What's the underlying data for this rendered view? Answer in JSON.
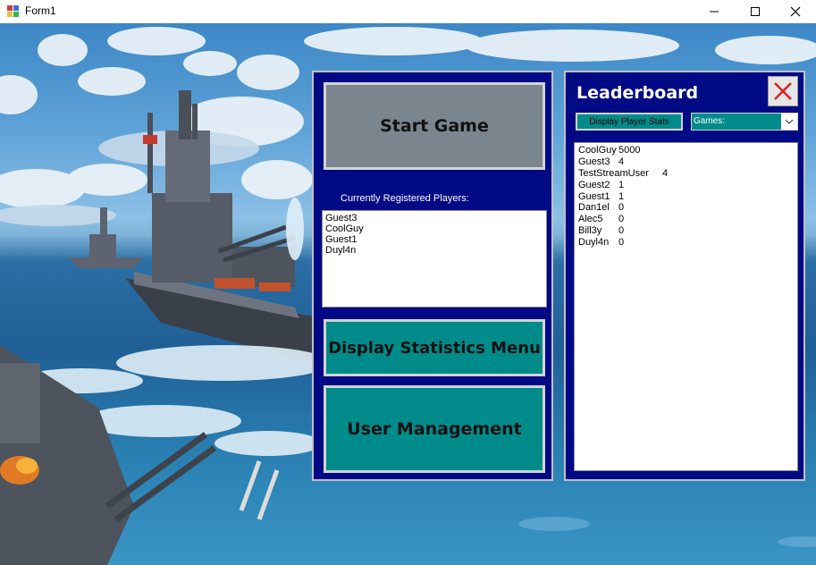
{
  "window": {
    "title": "Form1",
    "minimize_icon": "minimize-icon",
    "maximize_icon": "maximize-icon",
    "close_icon": "close-icon"
  },
  "menu": {
    "start_label": "Start Game",
    "registered_label": "Currently Registered Players:",
    "players": [
      "Guest3",
      "CoolGuy",
      "Guest1",
      "Duyl4n"
    ],
    "stats_label": "Display Statistics Menu",
    "users_label": "User Management"
  },
  "leaderboard": {
    "title": "Leaderboard",
    "close_icon": "red-x-icon",
    "display_button": "Display Player Stats",
    "games_select": "Games:",
    "rows": [
      {
        "name": "CoolGuy",
        "score": "5000"
      },
      {
        "name": "Guest3",
        "score": "4"
      },
      {
        "name": "TestStreamUser",
        "score": "4"
      },
      {
        "name": "Guest2",
        "score": "1"
      },
      {
        "name": "Guest1",
        "score": "1"
      },
      {
        "name": "Dan1el",
        "score": "0"
      },
      {
        "name": "Alec5",
        "score": "0"
      },
      {
        "name": "Bill3y",
        "score": "0"
      },
      {
        "name": "Duyl4n",
        "score": "0"
      }
    ]
  },
  "colors": {
    "panel": "#000a85",
    "teal": "#008b8b",
    "gray_button": "#7a858e"
  }
}
